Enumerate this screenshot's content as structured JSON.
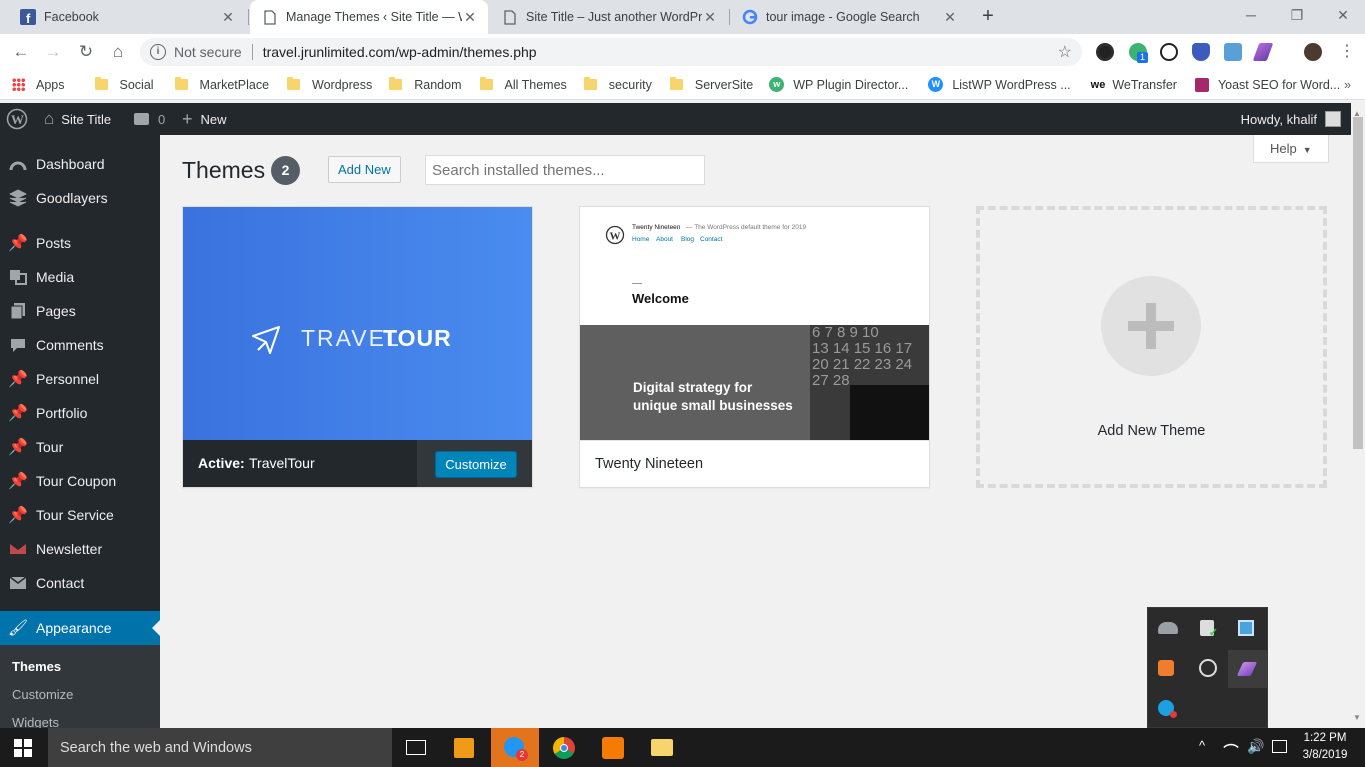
{
  "browser": {
    "tabs": [
      {
        "title": "Facebook",
        "icon": "facebook-icon",
        "active": false
      },
      {
        "title": "Manage Themes ‹ Site Title — W",
        "icon": "page-icon",
        "active": true
      },
      {
        "title": "Site Title – Just another WordPre",
        "icon": "page-icon",
        "active": false
      },
      {
        "title": "tour image - Google Search",
        "icon": "google-icon",
        "active": false
      }
    ],
    "security_label": "Not secure",
    "url": "travel.jrunlimited.com/wp-admin/themes.php",
    "bookmarks": [
      {
        "label": "Apps",
        "icon": "apps-grid-icon"
      },
      {
        "label": "Social",
        "icon": "folder-icon"
      },
      {
        "label": "MarketPlace",
        "icon": "folder-icon"
      },
      {
        "label": "Wordpress",
        "icon": "folder-icon"
      },
      {
        "label": "Random",
        "icon": "folder-icon"
      },
      {
        "label": "All Themes",
        "icon": "folder-icon"
      },
      {
        "label": "security",
        "icon": "folder-icon"
      },
      {
        "label": "ServerSite",
        "icon": "folder-icon"
      },
      {
        "label": "WP Plugin Director...",
        "icon": "wp-plugin-icon"
      },
      {
        "label": "ListWP WordPress ...",
        "icon": "listwp-icon"
      },
      {
        "label": "WeTransfer",
        "icon": "wetransfer-icon"
      },
      {
        "label": "Yoast SEO for Word...",
        "icon": "yoast-icon"
      }
    ],
    "extension_badge": "1"
  },
  "adminbar": {
    "site_title": "Site Title",
    "comments_count": "0",
    "new_label": "New",
    "howdy": "Howdy, khalif"
  },
  "sidebar": {
    "items": [
      {
        "label": "Dashboard",
        "icon": "dashboard-icon"
      },
      {
        "label": "Goodlayers",
        "icon": "goodlayers-icon"
      },
      {
        "label": "Posts",
        "icon": "pin-icon"
      },
      {
        "label": "Media",
        "icon": "media-icon"
      },
      {
        "label": "Pages",
        "icon": "pages-icon"
      },
      {
        "label": "Comments",
        "icon": "comment-icon"
      },
      {
        "label": "Personnel",
        "icon": "pin-icon"
      },
      {
        "label": "Portfolio",
        "icon": "pin-icon"
      },
      {
        "label": "Tour",
        "icon": "pin-icon"
      },
      {
        "label": "Tour Coupon",
        "icon": "pin-icon"
      },
      {
        "label": "Tour Service",
        "icon": "pin-icon"
      },
      {
        "label": "Newsletter",
        "icon": "newsletter-icon"
      },
      {
        "label": "Contact",
        "icon": "mail-icon"
      },
      {
        "label": "Appearance",
        "icon": "brush-icon"
      }
    ],
    "submenu": [
      "Themes",
      "Customize",
      "Widgets"
    ]
  },
  "main": {
    "title": "Themes",
    "count": "2",
    "add_new": "Add New",
    "search_placeholder": "Search installed themes...",
    "help": "Help",
    "themes": [
      {
        "screenshot_logo_left": "TRAVEL",
        "screenshot_logo_right": "TOUR",
        "active_prefix": "Active:",
        "name": "TravelTour",
        "customize": "Customize"
      },
      {
        "name": "Twenty Nineteen",
        "preview_site": "Twenty Nineteen",
        "preview_tagline": "— The WordPress default theme for 2019",
        "preview_nav": [
          "Home",
          "About",
          "Blog",
          "Contact"
        ],
        "preview_welcome": "Welcome",
        "preview_headline_1": "Digital strategy for",
        "preview_headline_2": "unique small businesses"
      }
    ],
    "add_new_theme": "Add New Theme"
  },
  "taskbar": {
    "search_placeholder": "Search the web and Windows",
    "skype_badge": "2",
    "time": "1:22 PM",
    "date": "3/8/2019"
  },
  "colors": {
    "wp_dark": "#23282d",
    "wp_blue": "#0073aa",
    "travel_gradient_start": "#3b73e0",
    "travel_gradient_end": "#4c8df0"
  }
}
